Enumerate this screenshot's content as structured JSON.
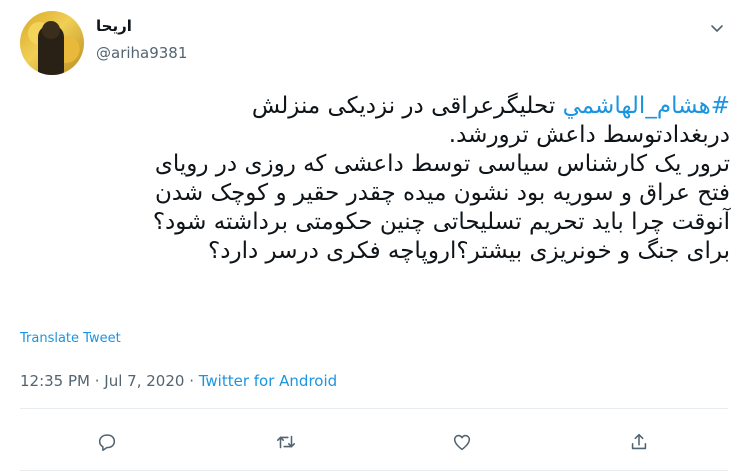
{
  "author": {
    "display_name": "اریحا",
    "handle": "@ariha9381"
  },
  "tweet": {
    "hashtag": "#هشام_الهاشمي",
    "line1_rest": " تحلیگرعراقی در نزدیکی منزلش",
    "line2": "دربغدادتوسط داعش ترورشد.",
    "line3": "ترور یک کارشناس سیاسی توسط داعشی که روزی در رویای",
    "line4": "فتح عراق و سوریه بود نشون میده چقدر حقیر و کوچک شدن",
    "line5": "آنوقت چرا باید تحریم تسلیحاتی چنین حکومتی برداشته شود؟",
    "line6": "برای جنگ و خونریزی بیشتر؟اروپاچه فکری درسر دارد؟"
  },
  "translate_label": "Translate Tweet",
  "meta": {
    "time": "12:35 PM",
    "separator": " · ",
    "date": "Jul 7, 2020",
    "source": "Twitter for Android"
  },
  "icons": {
    "caret": "chevron-down-icon",
    "reply": "reply-icon",
    "retweet": "retweet-icon",
    "like": "heart-icon",
    "share": "share-icon"
  },
  "colors": {
    "link": "#1b95e0",
    "muted": "#536471",
    "text": "#0f1419",
    "divider": "#e6ecf0"
  }
}
